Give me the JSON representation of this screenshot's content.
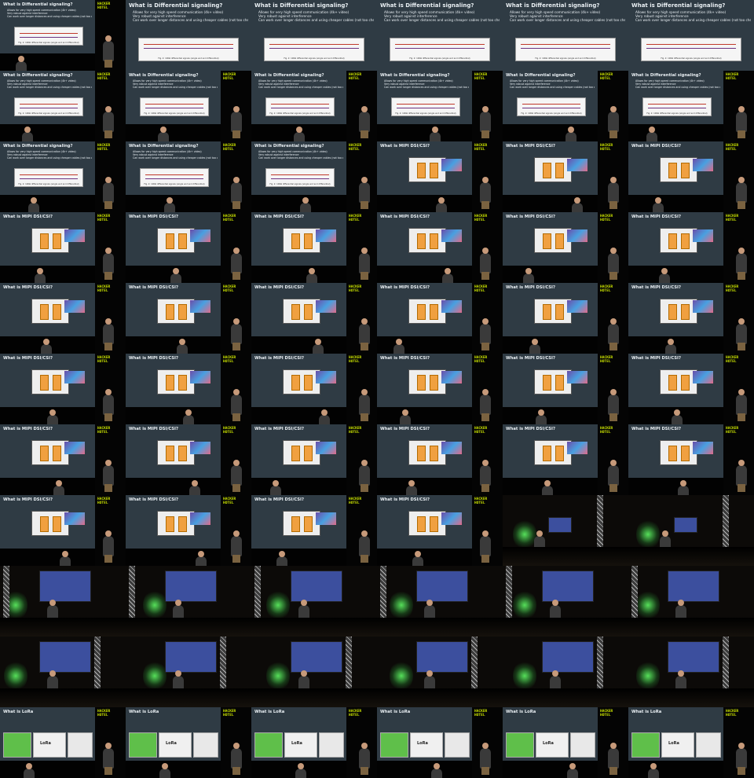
{
  "slides": {
    "differential": {
      "title": "What is Differential signaling?",
      "bullets": [
        "Allows for very high speed communication (4k+ video)",
        "Very robust against interference",
        "Can work over longer distances and using cheaper cables (not too cheap)"
      ],
      "caption": "Fig. 2: 100Ω differential signals (single end and differential)"
    },
    "mipi": {
      "title": "What is MIPI DSI/CSI?"
    },
    "lora": {
      "title": "What is LoRa",
      "word": "LoRa"
    }
  },
  "logo": {
    "line1": "HACKER",
    "line2": "HOTEL"
  },
  "layout_rows": [
    [
      "diff-small",
      "diff-wide",
      "diff-wide",
      "diff-wide",
      "diff-wide",
      "diff-wide"
    ],
    [
      "diff-big",
      "diff",
      "diff",
      "diff",
      "diff",
      "diff"
    ],
    [
      "diff",
      "diff",
      "diff",
      "mipi",
      "mipi",
      "mipi"
    ],
    [
      "mipi",
      "mipi",
      "mipi",
      "mipi",
      "mipi",
      "mipi"
    ],
    [
      "mipi",
      "mipi",
      "mipi",
      "mipi",
      "mipi",
      "mipi"
    ],
    [
      "mipi",
      "mipi",
      "mipi",
      "mipi",
      "mipi",
      "mipi"
    ],
    [
      "mipi",
      "mipi",
      "mipi",
      "mipi",
      "mipi",
      "mipi"
    ],
    [
      "mipi",
      "mipi",
      "mipi",
      "mipi",
      "stage",
      "stage"
    ],
    [
      "stage",
      "stage",
      "stage",
      "stage",
      "stage",
      "stage"
    ],
    [
      "stage",
      "stage",
      "stage",
      "stage",
      "stage",
      "stage"
    ],
    [
      "lora",
      "lora",
      "lora",
      "lora",
      "lora",
      "lora"
    ]
  ],
  "colors": {
    "slide_bg": "#2f3b44",
    "logo": "#c8e000",
    "screen": "#3c4f9e",
    "glow": "#56e05a"
  }
}
